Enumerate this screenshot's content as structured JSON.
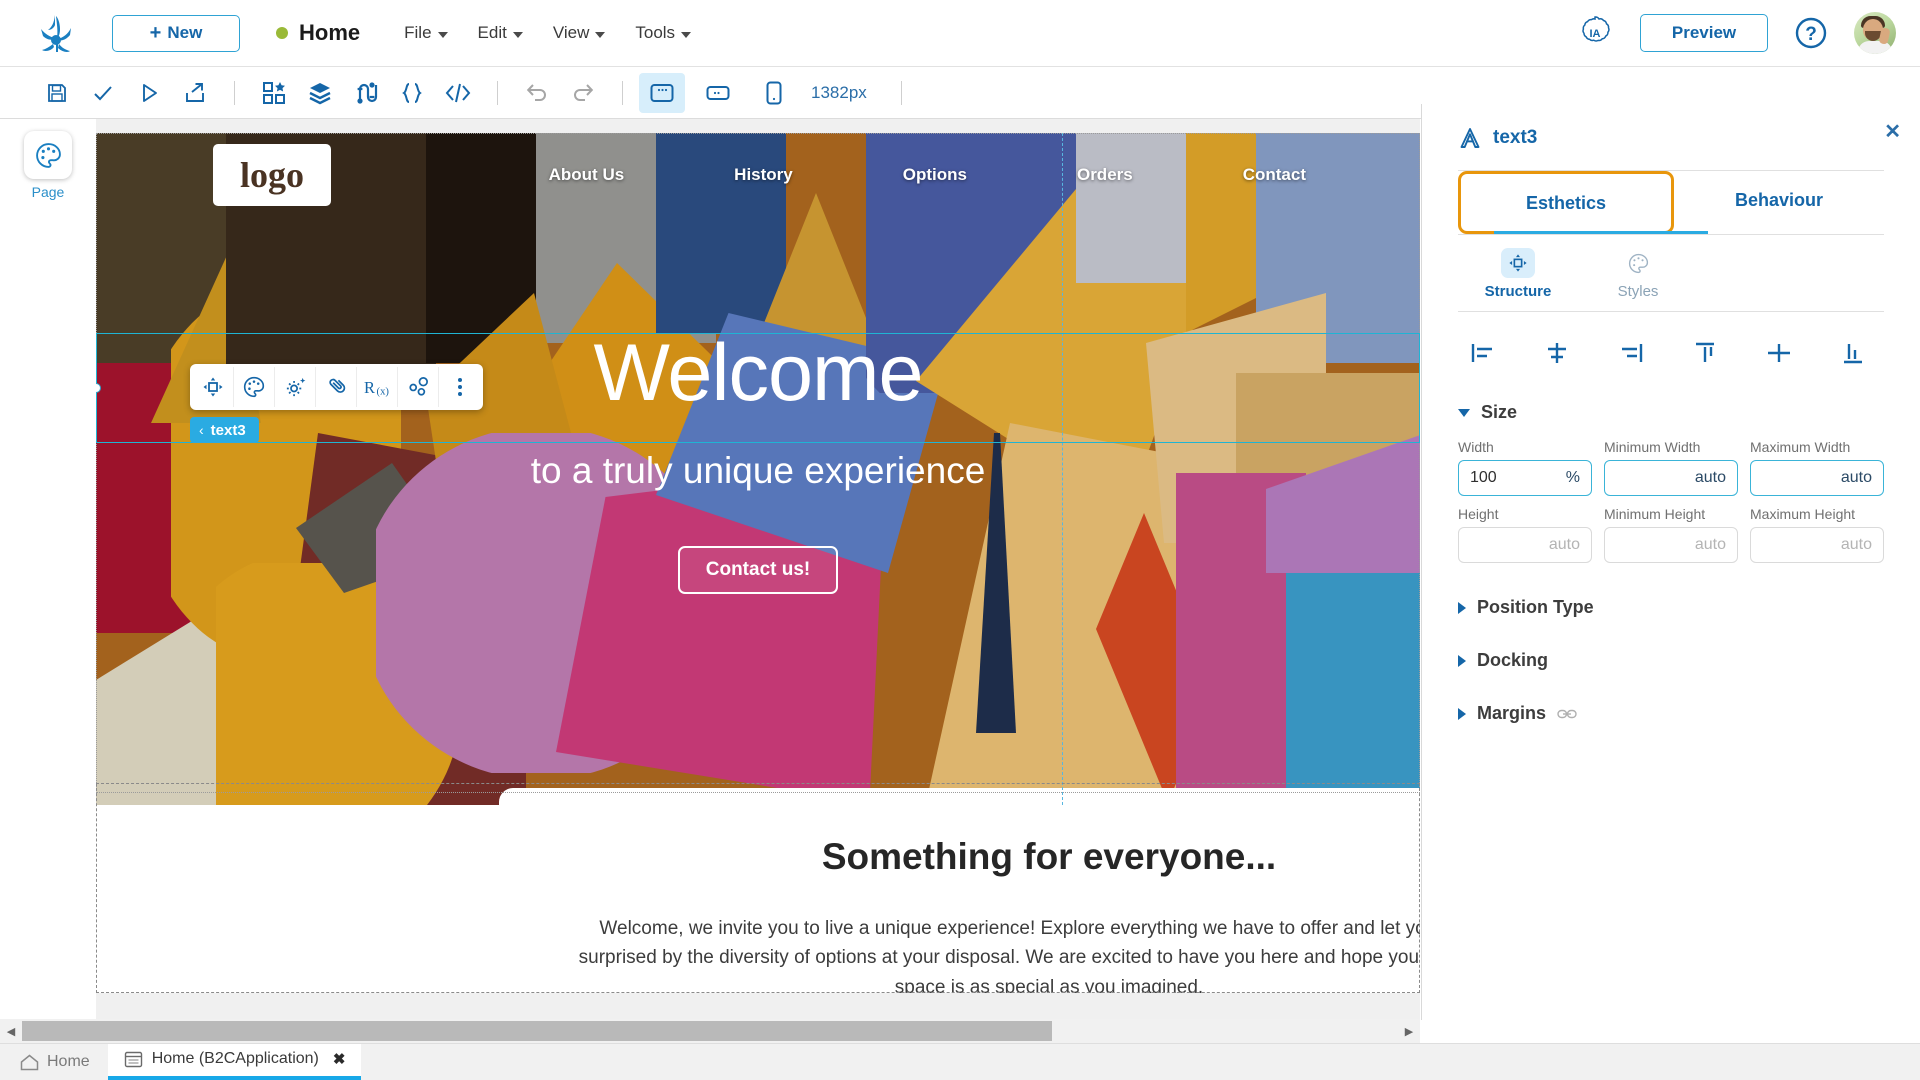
{
  "header": {
    "logo_icon": "app-logo-icon",
    "new_button": "New",
    "page_status_dot_color": "#9aba38",
    "page_title": "Home",
    "menus": [
      "File",
      "Edit",
      "View",
      "Tools"
    ],
    "ia_badge": "IA",
    "preview_button": "Preview",
    "help_icon": "question-circle-icon",
    "avatar": "user-avatar"
  },
  "toolbar": {
    "icons": [
      "save-icon",
      "check-icon",
      "play-icon",
      "publish-icon",
      "components-icon",
      "layers-icon",
      "flow-icon",
      "braces-icon",
      "code-icon",
      "undo-icon",
      "redo-icon"
    ],
    "viewports": [
      "desktop-viewport-icon",
      "tablet-viewport-icon",
      "mobile-viewport-icon"
    ],
    "active_viewport": "desktop-viewport-icon",
    "zoom_value": "1382px"
  },
  "left_rail": {
    "items": [
      {
        "label": "Page",
        "icon": "palette-icon"
      }
    ]
  },
  "canvas": {
    "float_toolbar_icons": [
      "structure-icon",
      "palette-icon",
      "settings-sparkle-icon",
      "link-icon",
      "expression-icon",
      "binding-icon",
      "more-vertical-icon"
    ],
    "selected_tag": "text3",
    "site": {
      "logo_text": "logo",
      "nav_links": [
        "About Us",
        "History",
        "Options",
        "Orders",
        "Contact"
      ],
      "hero_title": "Welcome",
      "hero_subtitle": "to a truly unique experience",
      "hero_cta": "Contact us!",
      "section_title": "Something for everyone...",
      "section_text": "Welcome, we invite you to live a unique experience! Explore everything we have to offer and let yourself be surprised by the diversity of options at your disposal. We are excited to have you here and hope your time in our space is as special as you imagined."
    }
  },
  "right_panel": {
    "close_icon": "close-icon",
    "element_icon": "text-element-icon",
    "element_name": "text3",
    "tabs": [
      {
        "label": "Esthetics",
        "selected": true
      },
      {
        "label": "Behaviour",
        "selected": false
      }
    ],
    "sub_tabs": [
      {
        "label": "Structure",
        "icon": "structure-icon",
        "active": true
      },
      {
        "label": "Styles",
        "icon": "palette-icon",
        "active": false
      }
    ],
    "align_buttons": [
      "align-left-icon",
      "align-center-horizontal-icon",
      "align-right-icon",
      "align-top-icon",
      "align-center-vertical-icon",
      "align-bottom-icon"
    ],
    "sections": [
      {
        "title": "Size",
        "expanded": true
      },
      {
        "title": "Position Type",
        "expanded": false
      },
      {
        "title": "Docking",
        "expanded": false
      },
      {
        "title": "Margins",
        "expanded": false,
        "link_icon": "link-chain-icon"
      }
    ],
    "size_fields": [
      {
        "label": "Width",
        "value": "100",
        "unit": "%",
        "placeholder": "",
        "active": true
      },
      {
        "label": "Minimum Width",
        "value": "auto",
        "unit": "",
        "placeholder": "auto",
        "active": true
      },
      {
        "label": "Maximum Width",
        "value": "auto",
        "unit": "",
        "placeholder": "auto",
        "active": true
      },
      {
        "label": "Height",
        "value": "",
        "unit": "",
        "placeholder": "auto",
        "active": false
      },
      {
        "label": "Minimum Height",
        "value": "",
        "unit": "",
        "placeholder": "auto",
        "active": false
      },
      {
        "label": "Maximum Height",
        "value": "",
        "unit": "",
        "placeholder": "auto",
        "active": false
      }
    ],
    "highlight_color": "#e8960c",
    "accent_color": "#2aabe2"
  },
  "bottom": {
    "home_label": "Home",
    "open_tab": "Home (B2CApplication)",
    "close_icon": "close-icon",
    "scroll_left": "◀",
    "scroll_right": "▶"
  }
}
